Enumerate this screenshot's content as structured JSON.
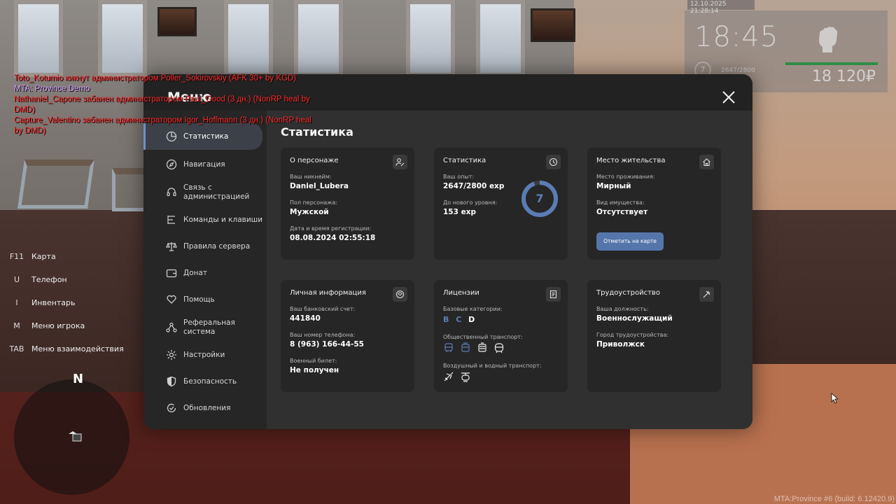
{
  "hud": {
    "datetime": "12.10.2025 21:28:14",
    "time": "18:45",
    "level": "7",
    "exp": "2647/2800",
    "money": "18 120₽"
  },
  "chat": [
    {
      "text": "Toto_Kotumio кикнут администратором Poller_Sokirovskiy (AFK 30+ by KGD)",
      "color": "#ff2a2a"
    },
    {
      "text": "MTA: Province Demo",
      "color": "#d39cff"
    },
    {
      "text": "Nathaniel_Capone забанен администратором Paul_Good (3 дн.) (NonRP heal by",
      "color": "#ff2a2a"
    },
    {
      "text": " DMD)",
      "color": "#ff2a2a"
    },
    {
      "text": "Capture_Valentino забанен администратором Igor_Hoffmann (3 дн.) (NonRP heal",
      "color": "#ff2a2a"
    },
    {
      "text": " by DMD)",
      "color": "#ff2a2a"
    }
  ],
  "binds": [
    {
      "key": "F11",
      "label": "Карта"
    },
    {
      "key": "U",
      "label": "Телефон"
    },
    {
      "key": "I",
      "label": "Инвентарь"
    },
    {
      "key": "M",
      "label": "Меню игрока"
    },
    {
      "key": "TAB",
      "label": "Меню взаимодействия"
    }
  ],
  "minimap": {
    "north": "N"
  },
  "build": "MTA:Province #6 (build: 6.12420.9)",
  "menu": {
    "title": "Меню",
    "nav": [
      {
        "label": "Статистика",
        "icon": "pie-chart-icon"
      },
      {
        "label": "Навигация",
        "icon": "compass-icon"
      },
      {
        "label": "Связь с администрацией",
        "icon": "headset-icon"
      },
      {
        "label": "Команды и клавиши",
        "icon": "list-icon"
      },
      {
        "label": "Правила сервера",
        "icon": "scales-icon"
      },
      {
        "label": "Донат",
        "icon": "wallet-icon"
      },
      {
        "label": "Помощь",
        "icon": "heart-hand-icon"
      },
      {
        "label": "Реферальная система",
        "icon": "network-icon"
      },
      {
        "label": "Настройки",
        "icon": "gear-icon"
      },
      {
        "label": "Безопасность",
        "icon": "shield-icon"
      },
      {
        "label": "Обновления",
        "icon": "refresh-check-icon"
      }
    ],
    "content_title": "Статистика",
    "cards": {
      "person": {
        "title": "О персонаже",
        "nick_label": "Ваш никнейм:",
        "nick": "Daniel_Lubera",
        "gender_label": "Пол персонажа:",
        "gender": "Мужской",
        "reg_label": "Дата и время регистрации:",
        "reg": "08.08.2024 02:55:18"
      },
      "stats": {
        "title": "Статистика",
        "exp_label": "Ваш опыт:",
        "exp": "2647/2800 exp",
        "next_label": "До нового уровня:",
        "next": "153 exp",
        "level": "7",
        "progress": 0.945
      },
      "residence": {
        "title": "Место жительства",
        "place_label": "Место проживания:",
        "place": "Мирный",
        "property_label": "Вид имущества:",
        "property": "Отсутствует",
        "button": "Отметить на карте"
      },
      "personal": {
        "title": "Личная информация",
        "bank_label": "Ваш банковский счет:",
        "bank": "441840",
        "phone_label": "Ваш номер телефона:",
        "phone": "8 (963) 166-44-55",
        "military_label": "Военный билет:",
        "military": "Не получен"
      },
      "licenses": {
        "title": "Лицензии",
        "base_label": "Базовые категории:",
        "categories": [
          {
            "name": "B",
            "color": "#5b7db5"
          },
          {
            "name": "C",
            "color": "#5b7db5"
          },
          {
            "name": "D",
            "color": "#ffffff"
          }
        ],
        "public_label": "Общественный транспорт:",
        "public_icons": [
          "bus-icon",
          "trolleybus-icon",
          "tram-icon",
          "metro-icon"
        ],
        "air_label": "Воздушный и водный транспорт:",
        "air_icons": [
          "plane-icon",
          "helicopter-icon"
        ]
      },
      "job": {
        "title": "Трудоустройство",
        "position_label": "Ваша должность:",
        "position": "Военнослужащий",
        "city_label": "Город трудоустройства:",
        "city": "Приволжск"
      }
    }
  }
}
